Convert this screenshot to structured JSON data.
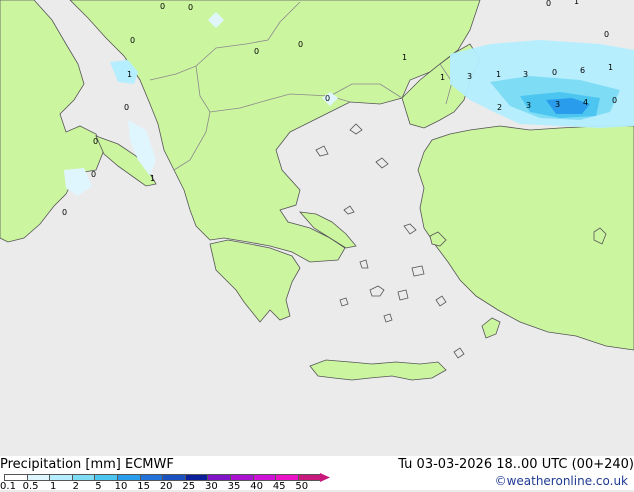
{
  "map": {
    "title_left": "Precipitation [mm]  ECMWF",
    "title_right": "Tu 03-03-2026 18..00 UTC (00+240)",
    "credit": "©weatheronline.co.uk",
    "colors": {
      "sea": "#ebebeb",
      "land": "#ccf5a0",
      "border": "#8a8a8a",
      "coast": "#555555"
    },
    "legend": {
      "labels": [
        "0.1",
        "0.5",
        "1",
        "2",
        "5",
        "10",
        "15",
        "20",
        "25",
        "30",
        "35",
        "40",
        "45",
        "50"
      ],
      "colors": [
        "#ffffff",
        "#dff6ff",
        "#b4eeff",
        "#7fdcf5",
        "#4cc6f0",
        "#2a9cec",
        "#2272d8",
        "#1b52c0",
        "#0c1f9a",
        "#7f14c8",
        "#a812d0",
        "#d012d8",
        "#ec12c8",
        "#c8187c"
      ]
    },
    "point_labels": [
      "0",
      "0",
      "0",
      "0",
      "1",
      "0",
      "0",
      "0",
      "1",
      "0",
      "0",
      "1",
      "0",
      "1",
      "3",
      "1",
      "3",
      "0",
      "6",
      "1",
      "2",
      "3",
      "3",
      "4",
      "0",
      "0",
      "0",
      "1"
    ]
  }
}
